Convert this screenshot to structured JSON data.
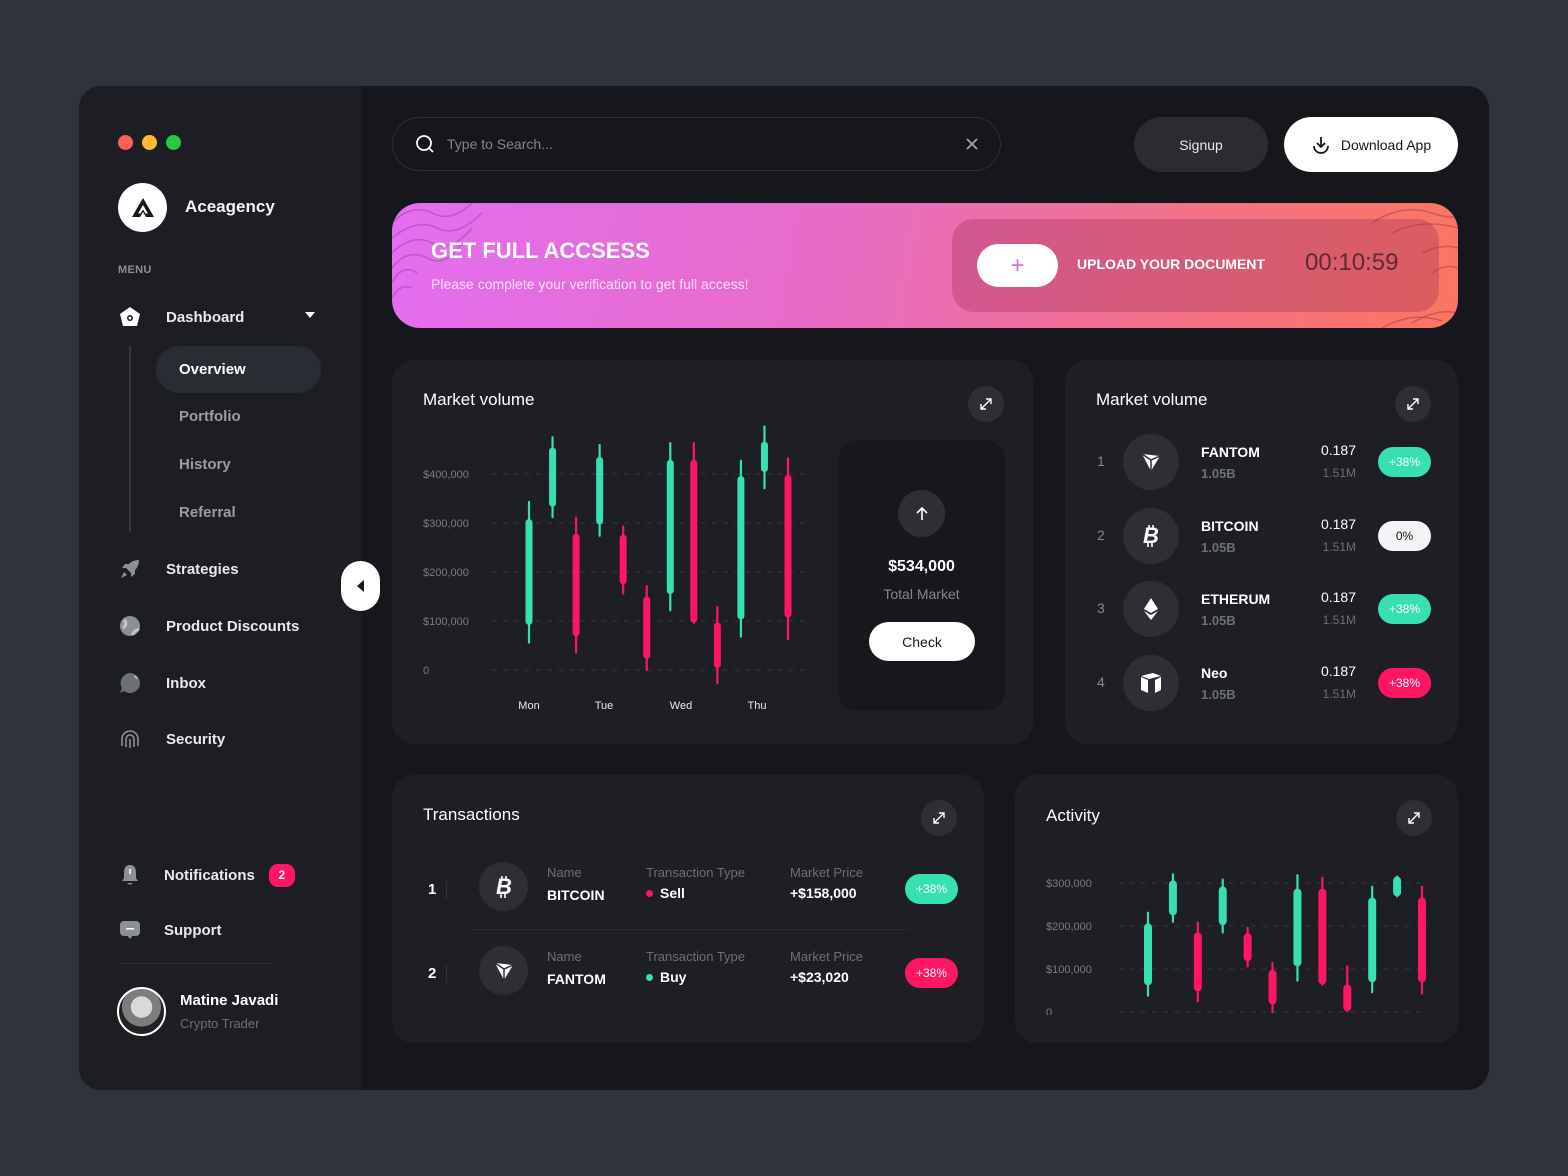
{
  "window": {
    "controls": [
      {
        "name": "close",
        "color": "#ff5f57"
      },
      {
        "name": "minimize",
        "color": "#febc2e"
      },
      {
        "name": "maximize",
        "color": "#28c840"
      }
    ]
  },
  "brand": {
    "name": "Aceagency"
  },
  "sidebar": {
    "menu_label": "MENU",
    "dashboard": {
      "label": "Dashboard",
      "expanded": true
    },
    "sub_items": [
      {
        "label": "Overview",
        "active": true
      },
      {
        "label": "Portfolio",
        "active": false
      },
      {
        "label": "History",
        "active": false
      },
      {
        "label": "Referral",
        "active": false
      }
    ],
    "items": [
      {
        "label": "Strategies",
        "icon": "rocket-icon"
      },
      {
        "label": "Product Discounts",
        "icon": "globe-icon"
      },
      {
        "label": "Inbox",
        "icon": "chat-bubble-icon"
      },
      {
        "label": "Security",
        "icon": "fingerprint-icon"
      }
    ],
    "notifications": {
      "label": "Notifications",
      "count": "2"
    },
    "support": {
      "label": "Support"
    },
    "user": {
      "name": "Matine Javadi",
      "role": "Crypto Trader"
    }
  },
  "header": {
    "search_placeholder": "Type to Search...",
    "search_value": "",
    "signup_label": "Signup",
    "download_label": "Download App"
  },
  "banner": {
    "title": "GET FULL ACCSESS",
    "subtitle": "Please complete your verification to get full access!",
    "upload_label": "UPLOAD YOUR DOCUMENT",
    "plus_label": "+",
    "timer": "00:10:59"
  },
  "market_chart_card": {
    "title": "Market volume",
    "total_value": "$534,000",
    "total_label": "Total Market",
    "check_label": "Check"
  },
  "market_list": {
    "title": "Market volume",
    "rows": [
      {
        "rank": "1",
        "name": "FANTOM",
        "supply": "1.05B",
        "price": "0.187",
        "volume": "1.51M",
        "change": "+38%",
        "change_style": "green",
        "icon": "fantom-icon"
      },
      {
        "rank": "2",
        "name": "BITCOIN",
        "supply": "1.05B",
        "price": "0.187",
        "volume": "1.51M",
        "change": "0%",
        "change_style": "white",
        "icon": "bitcoin-icon"
      },
      {
        "rank": "3",
        "name": "ETHERUM",
        "supply": "1.05B",
        "price": "0.187",
        "volume": "1.51M",
        "change": "+38%",
        "change_style": "green",
        "icon": "ethereum-icon"
      },
      {
        "rank": "4",
        "name": "Neo",
        "supply": "1.05B",
        "price": "0.187",
        "volume": "1.51M",
        "change": "+38%",
        "change_style": "red",
        "icon": "neo-icon"
      }
    ]
  },
  "transactions": {
    "title": "Transactions",
    "name_label": "Name",
    "type_label": "Transaction Type",
    "price_label": "Market Price",
    "rows": [
      {
        "rank": "1",
        "name": "BITCOIN",
        "type": "Sell",
        "type_color": "#ff1663",
        "price": "+$158,000",
        "change": "+38%",
        "change_style": "green",
        "icon": "bitcoin-icon"
      },
      {
        "rank": "2",
        "name": "FANTOM",
        "type": "Buy",
        "type_color": "#37e0b0",
        "price": "+$23,020",
        "change": "+38%",
        "change_style": "red",
        "icon": "fantom-icon"
      }
    ]
  },
  "activity": {
    "title": "Activity"
  },
  "colors": {
    "up": "#37e0b0",
    "down": "#ff1663",
    "accent_gradient_start": "#e36ef0",
    "accent_gradient_end": "#fb7661"
  },
  "chart_data": [
    {
      "id": "market-volume",
      "type": "candlestick",
      "title": "Market volume",
      "xlabel": "",
      "ylabel": "",
      "ylim": [
        0,
        400000
      ],
      "yticks": [
        0,
        100000,
        200000,
        300000,
        400000
      ],
      "ytick_labels": [
        "0",
        "$100,000",
        "$200,000",
        "$300,000",
        "$400,000"
      ],
      "categories": [
        "Mon",
        "Tue",
        "Wed",
        "Thu"
      ],
      "grid": true,
      "candles": [
        {
          "open": 92000,
          "close": 308000,
          "high": 343000,
          "low": 56000
        },
        {
          "open": 333000,
          "close": 454000,
          "high": 475000,
          "low": 312000
        },
        {
          "open": 278000,
          "close": 69000,
          "high": 311000,
          "low": 36000
        },
        {
          "open": 297000,
          "close": 435000,
          "high": 459000,
          "low": 274000
        },
        {
          "open": 276000,
          "close": 175000,
          "high": 293000,
          "low": 156000
        },
        {
          "open": 150000,
          "close": 23000,
          "high": 171000,
          "low": 0
        },
        {
          "open": 155000,
          "close": 429000,
          "high": 463000,
          "low": 122000
        },
        {
          "open": 429000,
          "close": 97000,
          "high": 463000,
          "low": 97000
        },
        {
          "open": 97000,
          "close": 4000,
          "high": 128000,
          "low": -27000
        },
        {
          "open": 103000,
          "close": 396000,
          "high": 427000,
          "low": 68000
        },
        {
          "open": 404000,
          "close": 466000,
          "high": 497000,
          "low": 371000
        },
        {
          "open": 398000,
          "close": 107000,
          "high": 432000,
          "low": 63000
        }
      ]
    },
    {
      "id": "activity",
      "type": "candlestick",
      "title": "Activity",
      "xlabel": "",
      "ylabel": "",
      "ylim": [
        0,
        300000
      ],
      "yticks": [
        0,
        100000,
        200000,
        300000
      ],
      "ytick_labels": [
        "0",
        "$100,000",
        "$200,000",
        "$300,000"
      ],
      "categories": [],
      "grid": true,
      "candles": [
        {
          "open": 62000,
          "close": 206000,
          "high": 231000,
          "low": 38000
        },
        {
          "open": 225000,
          "close": 306000,
          "high": 320000,
          "low": 210000
        },
        {
          "open": 185000,
          "close": 48000,
          "high": 208000,
          "low": 25000
        },
        {
          "open": 202000,
          "close": 292000,
          "high": 308000,
          "low": 185000
        },
        {
          "open": 183000,
          "close": 118000,
          "high": 196000,
          "low": 106000
        },
        {
          "open": 98000,
          "close": 18000,
          "high": 114000,
          "low": 0
        },
        {
          "open": 106000,
          "close": 287000,
          "high": 318000,
          "low": 73000
        },
        {
          "open": 287000,
          "close": 64000,
          "high": 312000,
          "low": 64000
        },
        {
          "open": 64000,
          "close": 2000,
          "high": 106000,
          "low": 2000
        },
        {
          "open": 69000,
          "close": 266000,
          "high": 291000,
          "low": 46000
        },
        {
          "open": 269000,
          "close": 315000,
          "high": 315000,
          "low": 269000
        },
        {
          "open": 266000,
          "close": 69000,
          "high": 291000,
          "low": 43000
        }
      ]
    }
  ]
}
